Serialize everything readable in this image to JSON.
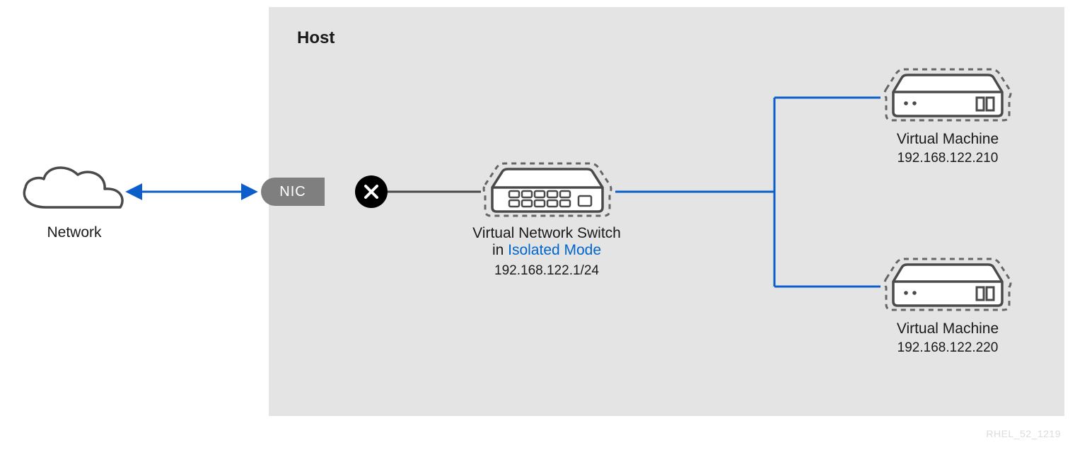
{
  "host_label": "Host",
  "network_label": "Network",
  "nic_label": "NIC",
  "switch": {
    "name": "Virtual Network Switch",
    "mode_prefix": "in ",
    "mode": "Isolated Mode",
    "ip": "192.168.122.1/24"
  },
  "vm1": {
    "name": "Virtual Machine",
    "ip": "192.168.122.210"
  },
  "vm2": {
    "name": "Virtual Machine",
    "ip": "192.168.122.220"
  },
  "footer": "RHEL_52_1219"
}
